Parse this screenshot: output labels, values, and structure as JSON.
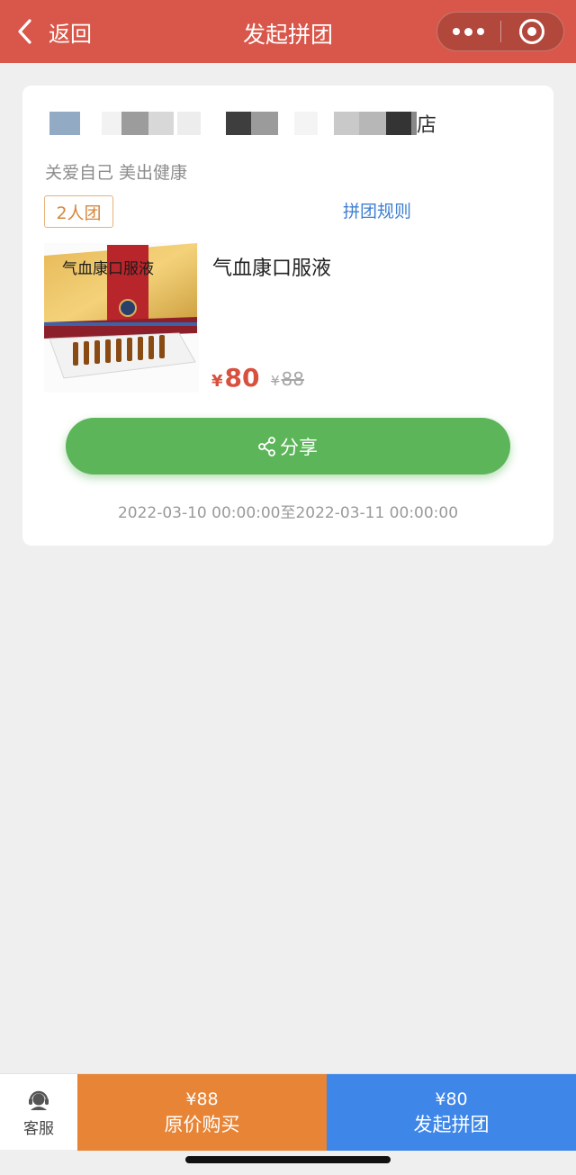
{
  "nav": {
    "back_label": "返回",
    "title": "发起拼团"
  },
  "card": {
    "store_name_tail": "店",
    "slogan": "关爱自己 美出健康",
    "group_tag": "2人团",
    "rules_link": "拼团规则",
    "product_name": "气血康口服液",
    "box_label": "气血康口服液",
    "currency": "¥",
    "group_price": "80",
    "original_price": "88",
    "share_label": "分享",
    "period": "2022-03-10 00:00:00至2022-03-11 00:00:00"
  },
  "bottom": {
    "service_label": "客服",
    "original_buy_price": "¥88",
    "original_buy_label": "原价购买",
    "group_buy_price": "¥80",
    "group_buy_label": "发起拼团"
  },
  "colors": {
    "nav_bg": "#d9574a",
    "share_green": "#5db55a",
    "price_red": "#d7513f",
    "orange_button": "#e78435",
    "blue_button": "#3e86e8",
    "link_blue": "#3f7fd1"
  },
  "icons": [
    "chevron-left-icon",
    "more-dots-icon",
    "close-target-icon",
    "share-icon",
    "customer-service-icon"
  ]
}
